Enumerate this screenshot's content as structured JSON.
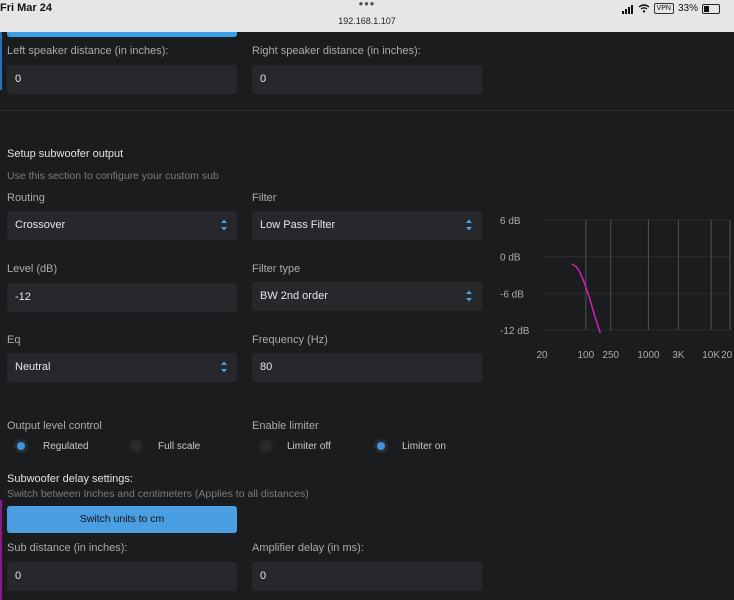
{
  "status_bar": {
    "date": "Fri Mar 24",
    "dots": "•••",
    "url": "192.168.1.107",
    "vpn": "VPN",
    "battery": "33%"
  },
  "speakers": {
    "left_label": "Left speaker distance (in inches):",
    "left_value": "0",
    "right_label": "Right speaker distance (in inches):",
    "right_value": "0"
  },
  "subwoofer": {
    "heading": "Setup subwoofer output",
    "hint": "Use this section to configure your custom sub",
    "routing_label": "Routing",
    "routing_value": "Crossover",
    "filter_label": "Filter",
    "filter_value": "Low Pass Filter",
    "level_label": "Level (dB)",
    "level_value": "-12",
    "filter_type_label": "Filter type",
    "filter_type_value": "BW 2nd order",
    "eq_label": "Eq",
    "eq_value": "Neutral",
    "frequency_label": "Frequency (Hz)",
    "frequency_value": "80",
    "output_level_label": "Output level control",
    "output_level_options": [
      "Regulated",
      "Full scale"
    ],
    "output_level_selected": "Regulated",
    "limiter_label": "Enable limiter",
    "limiter_options": [
      "Limiter off",
      "Limiter on"
    ],
    "limiter_selected": "Limiter on"
  },
  "delay": {
    "heading": "Subwoofer delay settings:",
    "hint": "Switch between Inches and centimeters (Applies to all distances)",
    "switch_button": "Switch units to cm",
    "sub_distance_label": "Sub distance (in inches):",
    "sub_distance_value": "0",
    "amp_delay_label": "Amplifier delay (in ms):",
    "amp_delay_value": "0"
  },
  "chart_data": {
    "type": "line",
    "y_ticks": [
      "6 dB",
      "0 dB",
      "-6 dB",
      "-12 dB"
    ],
    "y_values": [
      6,
      0,
      -6,
      -12
    ],
    "x_ticks": [
      "20",
      "100",
      "250",
      "1000",
      "3K",
      "10K",
      "20K"
    ],
    "x_values": [
      20,
      100,
      250,
      1000,
      3000,
      10000,
      20000
    ],
    "xscale": "log",
    "ylim": [
      -12,
      6
    ],
    "xlim": [
      20,
      20000
    ],
    "grid": true,
    "series": [
      {
        "color": "#d21fb6",
        "x": [
          60,
          70,
          80,
          95,
          115,
          140,
          170
        ],
        "y": [
          -1.2,
          -1.6,
          -2.5,
          -4.3,
          -6.8,
          -9.8,
          -12.5
        ]
      }
    ],
    "xlabel": "",
    "ylabel": "",
    "title": ""
  }
}
